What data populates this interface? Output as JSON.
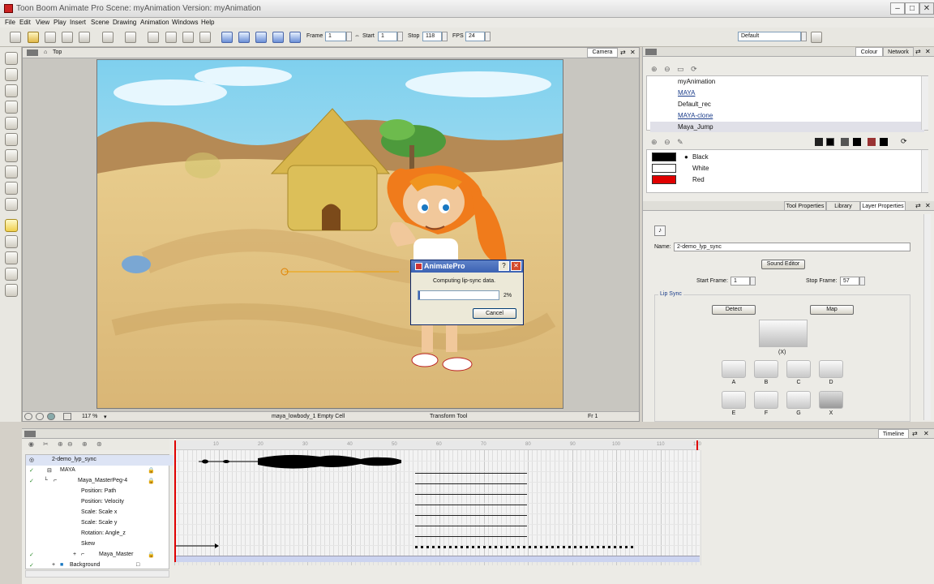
{
  "window": {
    "title": "Toon Boom Animate Pro Scene: myAnimation Version: myAnimation"
  },
  "menu": [
    "File",
    "Edit",
    "View",
    "Play",
    "Insert",
    "Scene",
    "Drawing",
    "Animation",
    "Windows",
    "Help"
  ],
  "toolbar": {
    "frame_label": "Frame",
    "frame_value": "1",
    "start_label": "Start",
    "start_value": "1",
    "stop_label": "Stop",
    "stop_value": "118",
    "fps_label": "FPS",
    "fps_value": "24",
    "workspace_value": "Default"
  },
  "camera": {
    "tab_label": "Camera",
    "view_label": "Top",
    "zoom_value": "117 %",
    "status_cell": "maya_lowbody_1 Empty Cell",
    "status_tool": "Transform Tool",
    "status_frame": "Fr 1"
  },
  "dialog": {
    "title": "AnimatePro",
    "message": "Computing lip-sync data.",
    "progress_text": "2%",
    "progress_fraction": 0.02,
    "cancel_label": "Cancel"
  },
  "right": {
    "top_tabs": [
      "Colour",
      "Network"
    ],
    "palettes": [
      "myAnimation",
      "MAYA",
      "Default_rec",
      "MAYA-clone",
      "Maya_Jump"
    ],
    "colours": [
      {
        "name": "Black",
        "hex": "#000000"
      },
      {
        "name": "White",
        "hex": "#ffffff"
      },
      {
        "name": "Red",
        "hex": "#e00000"
      }
    ],
    "mid_tabs": [
      "Tool Properties",
      "Library",
      "Layer Properties"
    ],
    "name_label": "Name:",
    "name_value": "2-demo_lyp_sync",
    "sound_editor_label": "Sound Editor",
    "start_frame_label": "Start Frame:",
    "start_frame_value": "1",
    "stop_frame_label": "Stop Frame:",
    "stop_frame_value": "57",
    "lip_sync_label": "Lip Sync",
    "detect_label": "Detect",
    "map_label": "Map",
    "current_mouth_label": "(X)",
    "mouth_shapes": [
      "A",
      "B",
      "C",
      "D",
      "E",
      "F",
      "G",
      "X"
    ]
  },
  "timeline": {
    "tab_label": "Timeline",
    "layers": [
      {
        "name": "2-demo_lyp_sync"
      },
      {
        "name": "MAYA"
      },
      {
        "name": "Maya_MasterPeg-4"
      },
      {
        "name": "Position: Path"
      },
      {
        "name": "Position: Velocity"
      },
      {
        "name": "Scale: Scale x"
      },
      {
        "name": "Scale: Scale y"
      },
      {
        "name": "Rotation: Angle_z"
      },
      {
        "name": "Skew"
      },
      {
        "name": "Maya_Master"
      },
      {
        "name": "Background"
      }
    ],
    "ruler_ticks": [
      "10",
      "20",
      "30",
      "40",
      "50",
      "60",
      "70",
      "80",
      "90",
      "100",
      "110",
      "120"
    ]
  },
  "colors": {
    "accent": "#3c63b3",
    "playhead": "#e00000"
  }
}
